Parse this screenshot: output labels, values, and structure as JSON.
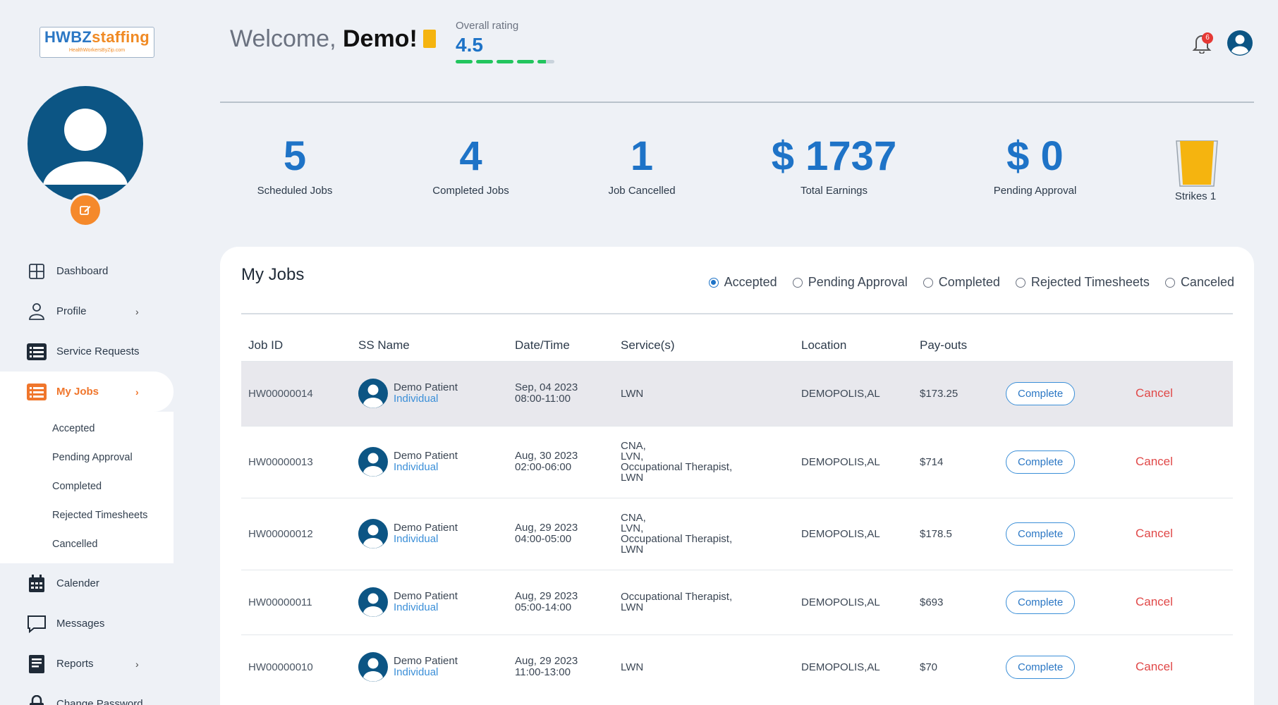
{
  "logo": {
    "main_a": "HWBZ",
    "main_b": "staffing",
    "sub": "HealthWorkersByZip.com"
  },
  "header": {
    "welcome_prefix": "Welcome,",
    "welcome_name": "Demo!",
    "rating_label": "Overall rating",
    "rating_value": "4.5",
    "rating_fraction": 0.9,
    "notification_count": "6"
  },
  "sidebar": {
    "items": [
      {
        "label": "Dashboard",
        "icon": "grid-icon"
      },
      {
        "label": "Profile",
        "icon": "user-icon"
      },
      {
        "label": "Service Requests",
        "icon": "list-icon"
      },
      {
        "label": "My Jobs",
        "icon": "list-icon"
      }
    ],
    "subitems": [
      "Accepted",
      "Pending Approval",
      "Completed",
      "Rejected Timesheets",
      "Cancelled"
    ],
    "bottom_items": [
      {
        "label": "Calender",
        "icon": "calendar-icon"
      },
      {
        "label": "Messages",
        "icon": "message-icon"
      },
      {
        "label": "Reports",
        "icon": "report-icon"
      },
      {
        "label": "Change Password",
        "icon": "lock-icon"
      }
    ]
  },
  "stats": [
    {
      "value": "5",
      "label": "Scheduled Jobs"
    },
    {
      "value": "4",
      "label": "Completed Jobs"
    },
    {
      "value": "1",
      "label": "Job Cancelled"
    },
    {
      "value": "$ 1737",
      "label": "Total Earnings"
    },
    {
      "value": "$ 0",
      "label": "Pending Approval"
    }
  ],
  "strikes": {
    "label": "Strikes 1"
  },
  "jobs": {
    "title": "My Jobs",
    "filters": [
      "Accepted",
      "Pending Approval",
      "Completed",
      "Rejected Timesheets",
      "Canceled"
    ],
    "selected_filter": "Accepted",
    "columns": [
      "Job ID",
      "SS Name",
      "Date/Time",
      "Service(s)",
      "Location",
      "Pay-outs"
    ],
    "complete_label": "Complete",
    "cancel_label": "Cancel",
    "rows": [
      {
        "id": "HW00000014",
        "name": "Demo Patient",
        "type": "Individual",
        "date": "Sep, 04 2023",
        "time": "08:00-11:00",
        "services": [
          "LWN"
        ],
        "location": "DEMOPOLIS,AL",
        "payout": "$173.25"
      },
      {
        "id": "HW00000013",
        "name": "Demo Patient",
        "type": "Individual",
        "date": "Aug, 30 2023",
        "time": "02:00-06:00",
        "services": [
          "CNA,",
          "LVN,",
          "Occupational Therapist,",
          "LWN"
        ],
        "location": "DEMOPOLIS,AL",
        "payout": "$714"
      },
      {
        "id": "HW00000012",
        "name": "Demo Patient",
        "type": "Individual",
        "date": "Aug, 29 2023",
        "time": "04:00-05:00",
        "services": [
          "CNA,",
          "LVN,",
          "Occupational Therapist,",
          "LWN"
        ],
        "location": "DEMOPOLIS,AL",
        "payout": "$178.5"
      },
      {
        "id": "HW00000011",
        "name": "Demo Patient",
        "type": "Individual",
        "date": "Aug, 29 2023",
        "time": "05:00-14:00",
        "services": [
          "Occupational Therapist,",
          "LWN"
        ],
        "location": "DEMOPOLIS,AL",
        "payout": "$693"
      },
      {
        "id": "HW00000010",
        "name": "Demo Patient",
        "type": "Individual",
        "date": "Aug, 29 2023",
        "time": "11:00-13:00",
        "services": [
          "LWN"
        ],
        "location": "DEMOPOLIS,AL",
        "payout": "$70"
      }
    ]
  },
  "colors": {
    "accent": "#1e73c7",
    "orange": "#f0762c",
    "navy": "#0c5584",
    "cancel": "#e04848",
    "strike": "#f5b40f"
  }
}
